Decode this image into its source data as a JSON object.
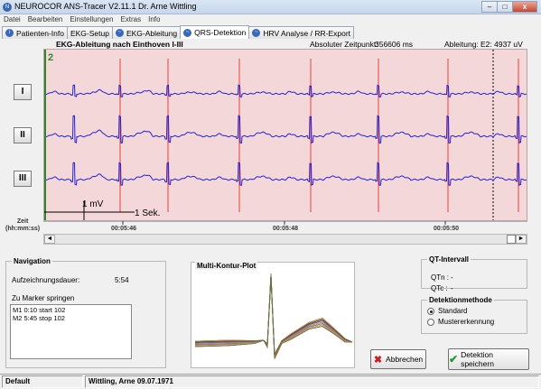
{
  "window": {
    "title": "NEUROCOR ANS-Tracer V2.11.1 Dr. Arne Wittling",
    "minimize": "–",
    "maximize": "□",
    "close": "x"
  },
  "menu": [
    "Datei",
    "Bearbeiten",
    "Einstellungen",
    "Extras",
    "Info"
  ],
  "tabs": [
    "Patienten-Info",
    "EKG-Setup",
    "EKG-Ableitung",
    "QRS-Detektion",
    "HRV Analyse / RR-Export"
  ],
  "active_tab": "QRS-Detektion",
  "ecg": {
    "title": "EKG-Ableitung nach Einthoven I-III",
    "abs_time_label": "Absoluter Zeitpunkt:",
    "abs_time_value": "356606 ms",
    "lead_label": "Ableitung:",
    "lead_value": "E2: 4937 uV",
    "marker_number": "2",
    "leads": [
      "I",
      "II",
      "III"
    ],
    "scale_mv": "1 mV",
    "scale_sec": "1 Sek.",
    "time_axis_label_1": "Zeit",
    "time_axis_label_2": "(hh:mm:ss)",
    "ticks": [
      "00:05:46",
      "00:05:48",
      "00:05:50"
    ],
    "scroll_left": "◄",
    "scroll_right": "►",
    "colors": {
      "background": "#f4d7d8",
      "trace": "#2323d2",
      "marker": "#e8403a",
      "green_line": "#2c8a2c"
    }
  },
  "navigation": {
    "legend": "Navigation",
    "duration_label": "Aufzeichnungsdauer:",
    "duration_value": "5:54",
    "jump_label": "Zu Marker springen",
    "markers": [
      "M1  0:10 start 102",
      "M2  5:45 stop 102"
    ]
  },
  "multi_kontur": {
    "title": "Multi-Kontur-Plot"
  },
  "qt": {
    "legend": "QT-Intervall",
    "qtn_label": "QTn :",
    "qtn_value": "-",
    "qtc_label": "QTc :",
    "qtc_value": "-"
  },
  "detection": {
    "legend": "Detektionmethode",
    "options": [
      "Standard",
      "Mustererkennung"
    ],
    "selected": "Standard"
  },
  "buttons": {
    "cancel": "Abbrechen",
    "save": "Detektion speichern"
  },
  "status": {
    "profile": "Default",
    "patient": "Wittling, Arne 09.07.1971"
  }
}
